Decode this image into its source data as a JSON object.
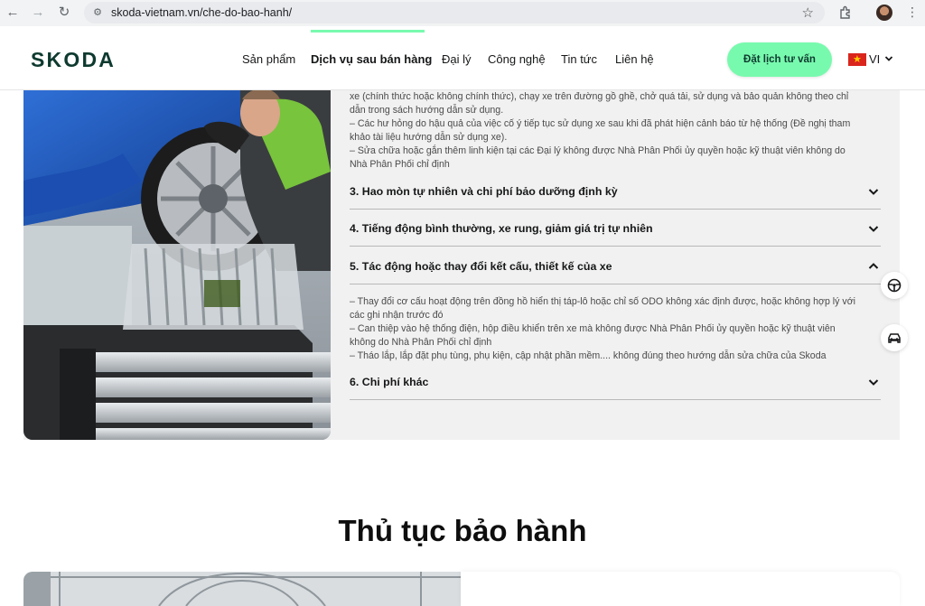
{
  "browser": {
    "url": "skoda-vietnam.vn/che-do-bao-hanh/"
  },
  "header": {
    "brand": "SKODA",
    "nav": [
      "Sản phẩm",
      "Dịch vụ sau bán hàng",
      "Đại lý",
      "Công nghệ",
      "Tin tức",
      "Liên hệ"
    ],
    "cta": "Đặt lịch tư vấn",
    "lang": "VI"
  },
  "content": {
    "top_lines": [
      "xe (chính thức hoặc không chính thức), chạy xe trên đường gồ ghề, chở quá tải, sử dụng và bảo quản không theo chỉ",
      "dẫn trong sách hướng dẫn sử dụng.",
      "– Các hư hỏng do hậu quả của việc cố ý tiếp tục sử dụng xe sau khi đã phát hiện cảnh báo từ hệ thống (Đề nghị tham",
      "khảo tài liệu hướng dẫn sử dụng xe).",
      "– Sửa chữa hoặc gắn thêm linh kiện tại các Đại lý không được Nhà Phân Phối ủy quyền hoặc kỹ thuật viên không do",
      "Nhà Phân Phối chỉ định"
    ],
    "accordion": [
      "3. Hao mòn tự nhiên và chi phí bảo dưỡng định kỳ",
      "4. Tiếng động bình thường, xe rung, giảm giá trị tự nhiên",
      "5. Tác động hoặc thay đổi kết cấu, thiết kế của xe",
      "6. Chi phí khác"
    ],
    "item5_lines": [
      "– Thay đổi cơ cấu hoạt động trên đồng hồ hiển thị táp-lô hoặc chỉ số ODO không xác định được, hoặc không hợp lý với",
      "các ghi nhận trước đó",
      "– Can thiệp vào hệ thống điện, hộp điều khiển trên xe mà không được Nhà Phân Phối ủy quyền hoặc kỹ thuật viên",
      "không do Nhà Phân Phối chỉ định",
      "– Tháo lắp, lắp đặt phụ tùng, phụ kiện, cập nhật phần mềm.... không đúng theo hướng dẫn sửa chữa của Skoda"
    ]
  },
  "section": {
    "title": "Thủ tục bảo hành"
  },
  "colors": {
    "accent": "#78faae",
    "brand": "#0e3a2f"
  }
}
